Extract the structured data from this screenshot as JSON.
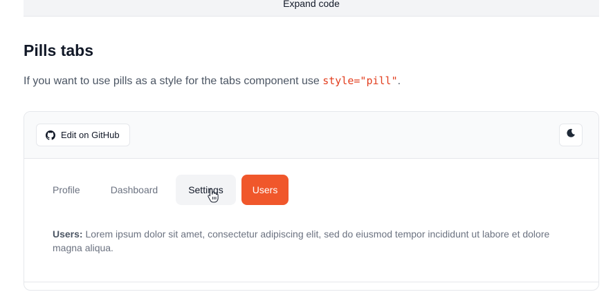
{
  "expand": {
    "label": "Expand code"
  },
  "section": {
    "title": "Pills tabs",
    "description_prefix": "If you want to use pills as a style for the tabs component use ",
    "description_code": "style=\"pill\"",
    "description_suffix": "."
  },
  "toolbar": {
    "github_label": "Edit on GitHub",
    "github_icon": "github-icon",
    "theme_icon": "moon-icon"
  },
  "tabs": [
    {
      "label": "Profile",
      "state": "default"
    },
    {
      "label": "Dashboard",
      "state": "default"
    },
    {
      "label": "Settings",
      "state": "hover"
    },
    {
      "label": "Users",
      "state": "active"
    }
  ],
  "content": {
    "label": "Users:",
    "text": " Lorem ipsum dolor sit amet, consectetur adipiscing elit, sed do eiusmod tempor incididunt ut labore et dolore magna aliqua."
  },
  "colors": {
    "accent": "#f0572b",
    "code": "#e23d1d",
    "border": "#e5e7eb"
  }
}
